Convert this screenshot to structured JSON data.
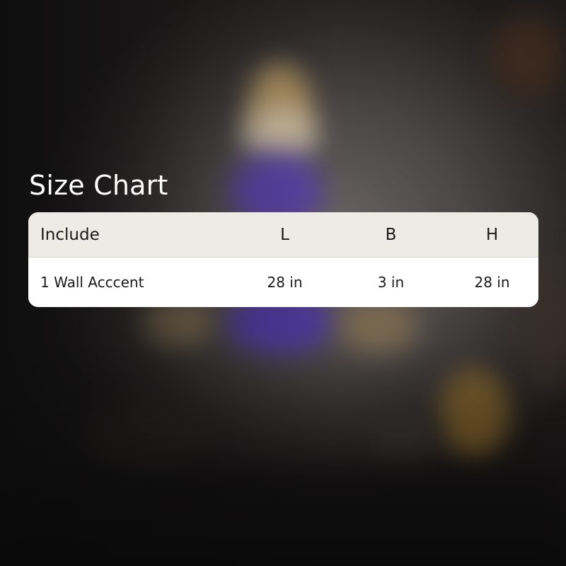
{
  "title": "Size Chart",
  "table": {
    "headers": [
      "Include",
      "L",
      "B",
      "H"
    ],
    "rows": [
      [
        "1 Wall Acccent",
        "28 in",
        "3 in",
        "28 in"
      ]
    ]
  }
}
